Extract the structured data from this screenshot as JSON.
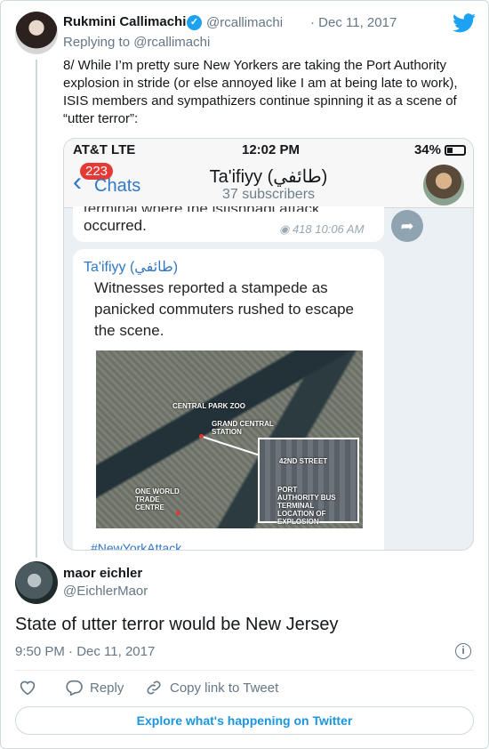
{
  "quoted": {
    "name": "Rukmini Callimachi",
    "handle": "@rcallimachi",
    "date": "· Dec 11, 2017",
    "replying_to": "Replying to @rcallimachi",
    "text": "8/ While I’m pretty sure New Yorkers are taking the Port Authority explosion in stride (or else annoyed like I am at being late to work), ISIS members and sympathizers continue spinning it as a scene of “utter terror”:"
  },
  "screenshot": {
    "carrier": "AT&T  LTE",
    "time": "12:02 PM",
    "battery": "34%",
    "badge": "223",
    "back_label": "Chats",
    "channel_title": "Ta'ifiyy (طائفي)",
    "subscribers": "37 subscribers",
    "msg1_cut": "terminal where the istishhadi attack",
    "msg1_text": "occurred.",
    "msg1_meta": "◉ 418  10:06 AM",
    "msg2_author": "Ta'ifiyy (طائفي)",
    "msg2_text": "Witnesses reported a stampede as panicked commuters rushed to escape the scene.",
    "map_labels": {
      "zoo": "CENTRAL PARK ZOO",
      "grand_central": "GRAND CENTRAL STATION",
      "wtc": "ONE WORLD TRADE CENTRE",
      "street": "42ND STREET",
      "port": "PORT AUTHORITY BUS TERMINAL LOCATION OF EXPLOSION"
    },
    "msg2_more": "#NewYorkAttack"
  },
  "tweet": {
    "name": "maor eichler",
    "handle": "@EichlerMaor",
    "text": "State of utter terror would be New Jersey",
    "time": "9:50 PM · Dec 11, 2017",
    "reply_label": "Reply",
    "copy_label": "Copy link to Tweet",
    "explore_label": "Explore what's happening on Twitter"
  },
  "colors": {
    "twitter_blue": "#1da1f2",
    "link_blue": "#1b95e0",
    "telegram_blue": "#3178c6",
    "muted": "#657786"
  }
}
